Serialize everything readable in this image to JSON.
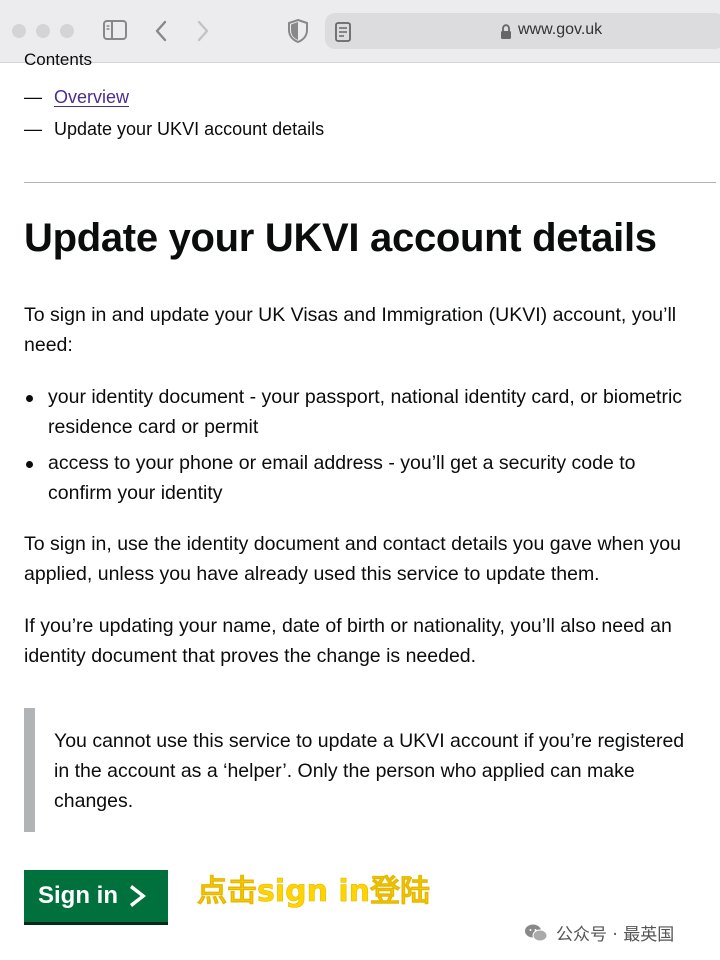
{
  "browser": {
    "url": "www.gov.uk",
    "icons": [
      "sidebar-icon",
      "back-arrow-icon",
      "forward-arrow-icon",
      "shield-icon",
      "reader-icon",
      "lock-icon"
    ]
  },
  "toc": {
    "heading": "Contents",
    "dash": "—",
    "items": [
      {
        "label": "Overview",
        "is_link": true
      },
      {
        "label": "Update your UKVI account details",
        "is_link": false
      }
    ]
  },
  "main": {
    "title": "Update your UKVI account details",
    "intro": "To sign in and update your UK Visas and Immigration (UKVI) account, you’ll need:",
    "bullets": [
      "your identity document - your passport, national identity card, or biometric residence card or permit",
      "access to your phone or email address - you’ll get a security code to confirm your identity"
    ],
    "para_signin": "To sign in, use the identity document and contact details you gave when you applied, unless you have already used this service to update them.",
    "para_updating": "If you’re updating your name, date of birth or nationality, you’ll also need an identity document that proves the change is needed.",
    "inset": "You cannot use this service to update a UKVI account if you’re registered in the account as a ‘helper’. Only the person who applied can make changes.",
    "button_label": "Sign in"
  },
  "annotation": "点击sign in登陆",
  "watermark": "公众号 · 最英国",
  "colors": {
    "link": "#4c2c92",
    "button": "#00703c",
    "inset_border": "#b1b4b6",
    "annotation": "#ffd400"
  }
}
